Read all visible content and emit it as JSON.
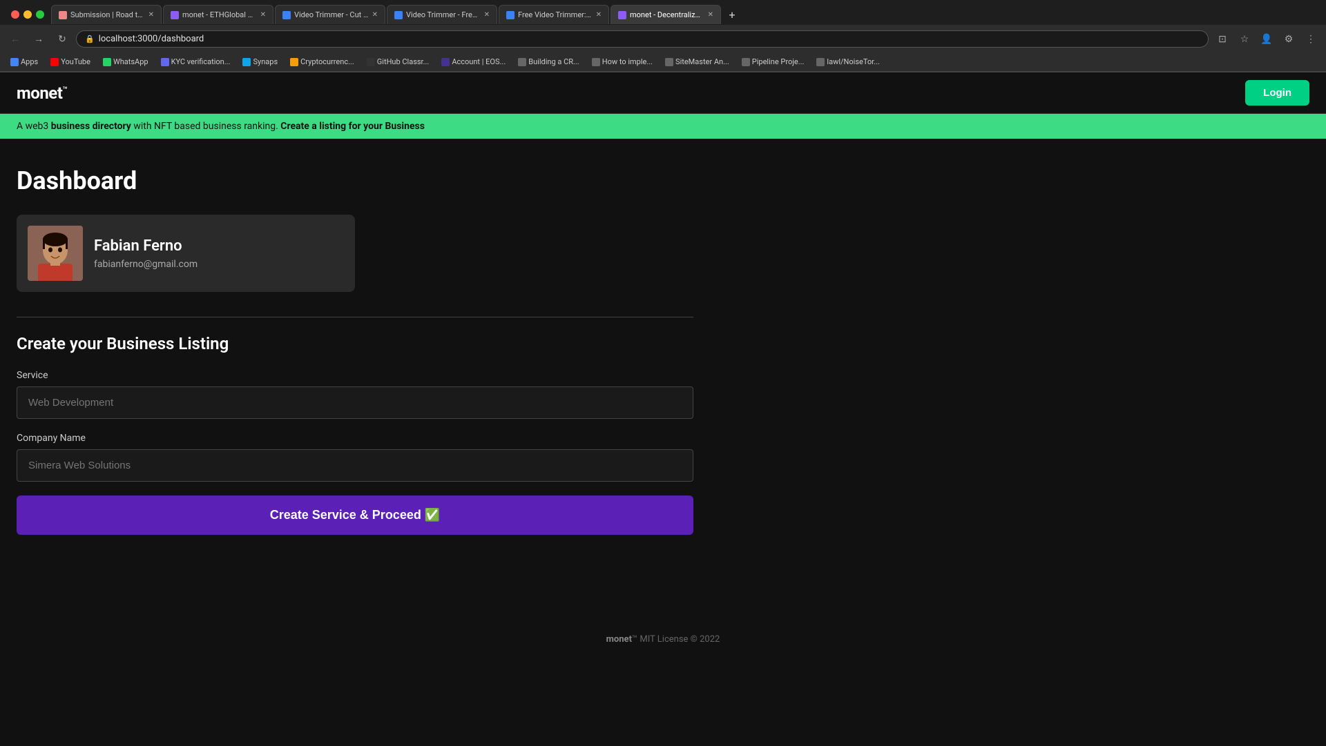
{
  "browser": {
    "tabs": [
      {
        "id": "tab1",
        "label": "Submission | Road to Web...",
        "active": false,
        "favicon": "doc"
      },
      {
        "id": "tab2",
        "label": "monet - ETHGlobal Show...",
        "active": false,
        "favicon": "m"
      },
      {
        "id": "tab3",
        "label": "Video Trimmer - Cut Vide...",
        "active": false,
        "favicon": "v"
      },
      {
        "id": "tab4",
        "label": "Video Trimmer - Free Onl...",
        "active": false,
        "favicon": "v"
      },
      {
        "id": "tab5",
        "label": "Free Video Trimmer: Cut...",
        "active": false,
        "favicon": "v"
      },
      {
        "id": "tab6",
        "label": "monet - Decentralized Bu...",
        "active": true,
        "favicon": "m"
      }
    ],
    "address": "localhost:3000/dashboard",
    "bookmarks": [
      {
        "label": "Apps",
        "icon": "grid"
      },
      {
        "label": "YouTube",
        "icon": "yt"
      },
      {
        "label": "WhatsApp",
        "icon": "wa"
      },
      {
        "label": "KYC verification...",
        "icon": "kyc"
      },
      {
        "label": "Synaps",
        "icon": "syn"
      },
      {
        "label": "Cryptocurrenc...",
        "icon": "crypto"
      },
      {
        "label": "GitHub Classr...",
        "icon": "gh"
      },
      {
        "label": "Account | EOS...",
        "icon": "eos"
      },
      {
        "label": "Building a CR...",
        "icon": "cr"
      },
      {
        "label": "How to imple...",
        "icon": "impl"
      },
      {
        "label": "SiteMaster An...",
        "icon": "site"
      },
      {
        "label": "Pipeline Proje...",
        "icon": "pipe"
      },
      {
        "label": "lawl/NoiseTor...",
        "icon": "noise"
      }
    ]
  },
  "app": {
    "logo": "monet",
    "logo_tm": "™",
    "login_label": "Login",
    "banner": {
      "prefix": "A web3 ",
      "bold": "business directory",
      "suffix": " with NFT based business ranking.",
      "link": "Create a listing for your Business"
    },
    "page_title": "Dashboard",
    "user": {
      "name": "Fabian Ferno",
      "email": "fabianferno@gmail.com"
    },
    "form": {
      "section_title": "Create your Business Listing",
      "service_label": "Service",
      "service_placeholder": "Web Development",
      "company_label": "Company Name",
      "company_placeholder": "Simera Web Solutions",
      "submit_label": "Create Service & Proceed ✅"
    },
    "footer": {
      "brand": "monet",
      "tm": "™",
      "license": " MIT License © 2022"
    }
  }
}
